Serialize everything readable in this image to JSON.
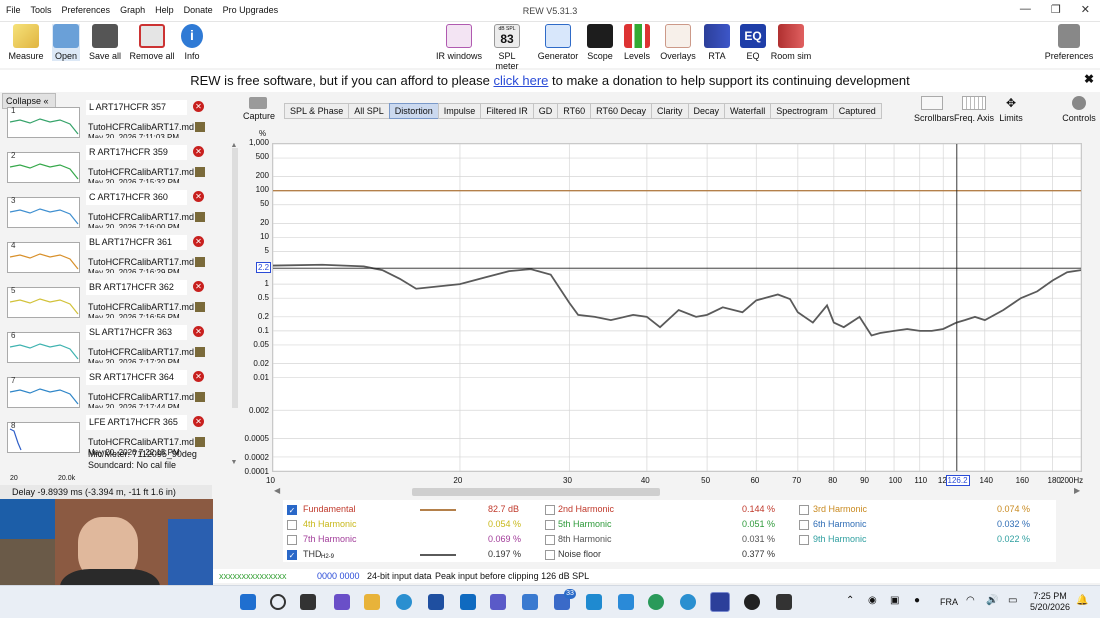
{
  "window": {
    "title": "REW V5.31.3"
  },
  "menu": [
    "File",
    "Tools",
    "Preferences",
    "Graph",
    "Help",
    "Donate",
    "Pro Upgrades"
  ],
  "toolbar_left": [
    "Measure",
    "Open",
    "Save all",
    "Remove all",
    "Info"
  ],
  "toolbar_right": [
    "IR windows",
    "SPL meter",
    "Generator",
    "Scope",
    "Levels",
    "Overlays",
    "RTA",
    "EQ",
    "Room sim"
  ],
  "spl_meter_badge": {
    "unit": "dB SPL",
    "value": "83"
  },
  "preferences_label": "Preferences",
  "banner": {
    "before": "REW is free software, but if you can afford to please ",
    "link": "click here",
    "after": " to make a donation to help support its continuing development"
  },
  "left_panel": {
    "collapse_label": "Collapse",
    "measurements": [
      {
        "num": "1",
        "title": "L ART17HCFR 357",
        "file": "TutoHCFRCalibART17.md",
        "date": "May 20, 2026 7:11:03 PM",
        "color": "#36a36a"
      },
      {
        "num": "2",
        "title": "R ART17HCFR 359",
        "file": "TutoHCFRCalibART17.md",
        "date": "May 20, 2026 7:15:32 PM",
        "color": "#35a84a"
      },
      {
        "num": "3",
        "title": "C ART17HCFR 360",
        "file": "TutoHCFRCalibART17.md",
        "date": "May 20, 2026 7:16:00 PM",
        "color": "#3f8fd0"
      },
      {
        "num": "4",
        "title": "BL ART17HCFR 361",
        "file": "TutoHCFRCalibART17.md",
        "date": "May 20, 2026 7:16:29 PM",
        "color": "#d8902a"
      },
      {
        "num": "5",
        "title": "BR ART17HCFR 362",
        "file": "TutoHCFRCalibART17.md",
        "date": "May 20, 2026 7:16:56 PM",
        "color": "#d2c23a"
      },
      {
        "num": "6",
        "title": "SL ART17HCFR 363",
        "file": "TutoHCFRCalibART17.md",
        "date": "May 20, 2026 7:17:20 PM",
        "color": "#3fb3b0"
      },
      {
        "num": "7",
        "title": "SR ART17HCFR 364",
        "file": "TutoHCFRCalibART17.md",
        "date": "May 20, 2026 7:17:44 PM",
        "color": "#2f86c8"
      },
      {
        "num": "8",
        "title": "LFE ART17HCFR 365",
        "file": "TutoHCFRCalibART17.md",
        "date": "May 20, 2026 7:22:15 PM",
        "color": "#2f5fc8"
      }
    ],
    "last_meta": {
      "mic": "Mic/Meter: 7112095_90deg",
      "soundcard": "Soundcard: No cal file"
    },
    "thumb_scale": {
      "left": "20",
      "right": "20.0k"
    },
    "delay": "Delay -9.8939 ms (-3.394 m, -11 ft 1.6 in)"
  },
  "capture_label": "Capture",
  "graph_tabs": [
    "SPL & Phase",
    "All SPL",
    "Distortion",
    "Impulse",
    "Filtered IR",
    "GD",
    "RT60",
    "RT60 Decay",
    "Clarity",
    "Decay",
    "Waterfall",
    "Spectrogram",
    "Captured"
  ],
  "active_tab": "Distortion",
  "graph_controls": [
    "Scrollbars",
    "Freq. Axis",
    "Limits"
  ],
  "controls_label": "Controls",
  "chart_data": {
    "type": "line",
    "ylabel": "%",
    "y_ticks": [
      "1,000",
      "500",
      "200",
      "100",
      "50",
      "20",
      "10",
      "5",
      "2",
      "1",
      "0.5",
      "0.2",
      "0.1",
      "0.05",
      "0.02",
      "0.01",
      "0.002",
      "0.0005",
      "0.0002",
      "0.0001"
    ],
    "x_ticks": [
      "10",
      "20",
      "30",
      "40",
      "50",
      "60",
      "70",
      "80",
      "90",
      "100",
      "110",
      "120",
      "140",
      "160",
      "180",
      "200Hz"
    ],
    "log_x": true,
    "log_y": true,
    "xlim": [
      10,
      200
    ],
    "ylim": [
      0.0001,
      1000
    ],
    "cursor": {
      "x_label": "126.2",
      "y_label": "2.2"
    },
    "series": [
      {
        "name": "Fundamental",
        "color": "#b4804a",
        "x": [
          10,
          200
        ],
        "y": [
          100,
          100
        ]
      },
      {
        "name": "THD",
        "color": "#5a5a5a",
        "x": [
          10,
          12,
          14,
          15,
          16,
          17,
          20,
          22,
          24,
          26,
          28,
          30,
          31,
          33,
          35,
          38,
          40,
          42,
          45,
          48,
          50,
          53,
          57,
          60,
          65,
          68,
          70,
          74,
          78,
          80,
          83,
          88,
          92,
          95,
          100,
          105,
          110,
          115,
          120,
          126,
          130,
          135,
          140,
          150,
          160,
          170,
          180,
          190,
          200
        ],
        "y": [
          2.5,
          2.6,
          2.4,
          2.0,
          1.3,
          0.8,
          1.0,
          1.4,
          1.9,
          2.1,
          1.6,
          0.4,
          0.22,
          0.2,
          0.17,
          0.22,
          0.2,
          0.12,
          0.28,
          0.2,
          0.22,
          0.32,
          0.25,
          0.45,
          0.6,
          0.48,
          0.25,
          0.15,
          0.35,
          0.15,
          0.12,
          0.2,
          0.08,
          0.09,
          0.1,
          0.11,
          0.1,
          0.1,
          0.11,
          0.15,
          0.17,
          0.2,
          0.17,
          0.28,
          0.5,
          0.7,
          1.2,
          1.8,
          2.0
        ]
      }
    ]
  },
  "legend": {
    "items": [
      {
        "label": "Fundamental",
        "value": "82.7 dB",
        "checked": true,
        "color": "#c0392b",
        "swatch": "#b4804a"
      },
      {
        "label": "2nd Harmonic",
        "value": "0.144 %",
        "checked": false,
        "color": "#c0392b",
        "swatch": ""
      },
      {
        "label": "3rd Harmonic",
        "value": "0.074 %",
        "checked": false,
        "color": "#c98a20",
        "swatch": ""
      },
      {
        "label": "4th Harmonic",
        "value": "0.054 %",
        "checked": false,
        "color": "#c8b81a",
        "swatch": ""
      },
      {
        "label": "5th Harmonic",
        "value": "0.051 %",
        "checked": false,
        "color": "#2e9a3a",
        "swatch": ""
      },
      {
        "label": "6th Harmonic",
        "value": "0.032 %",
        "checked": false,
        "color": "#2f6db5",
        "swatch": ""
      },
      {
        "label": "7th Harmonic",
        "value": "0.069 %",
        "checked": false,
        "color": "#a23d9a",
        "swatch": ""
      },
      {
        "label": "8th Harmonic",
        "value": "0.031 %",
        "checked": false,
        "color": "#555555",
        "swatch": ""
      },
      {
        "label": "9th Harmonic",
        "value": "0.022 %",
        "checked": false,
        "color": "#2f9fa0",
        "swatch": ""
      },
      {
        "label": "THD",
        "sub": "H2-9",
        "value": "0.197 %",
        "checked": true,
        "color": "#333333",
        "swatch": "#5a5a5a"
      },
      {
        "label": "Noise floor",
        "value": "0.377 %",
        "checked": false,
        "color": "#333333",
        "swatch": ""
      }
    ]
  },
  "status": {
    "bits": "0000 0000",
    "input": "24-bit input data",
    "peak": "Peak input before clipping 126 dB SPL"
  },
  "taskbar": {
    "time": "7:25 PM",
    "date": "5/20/2026",
    "lang": "FRA",
    "badge": "33"
  }
}
